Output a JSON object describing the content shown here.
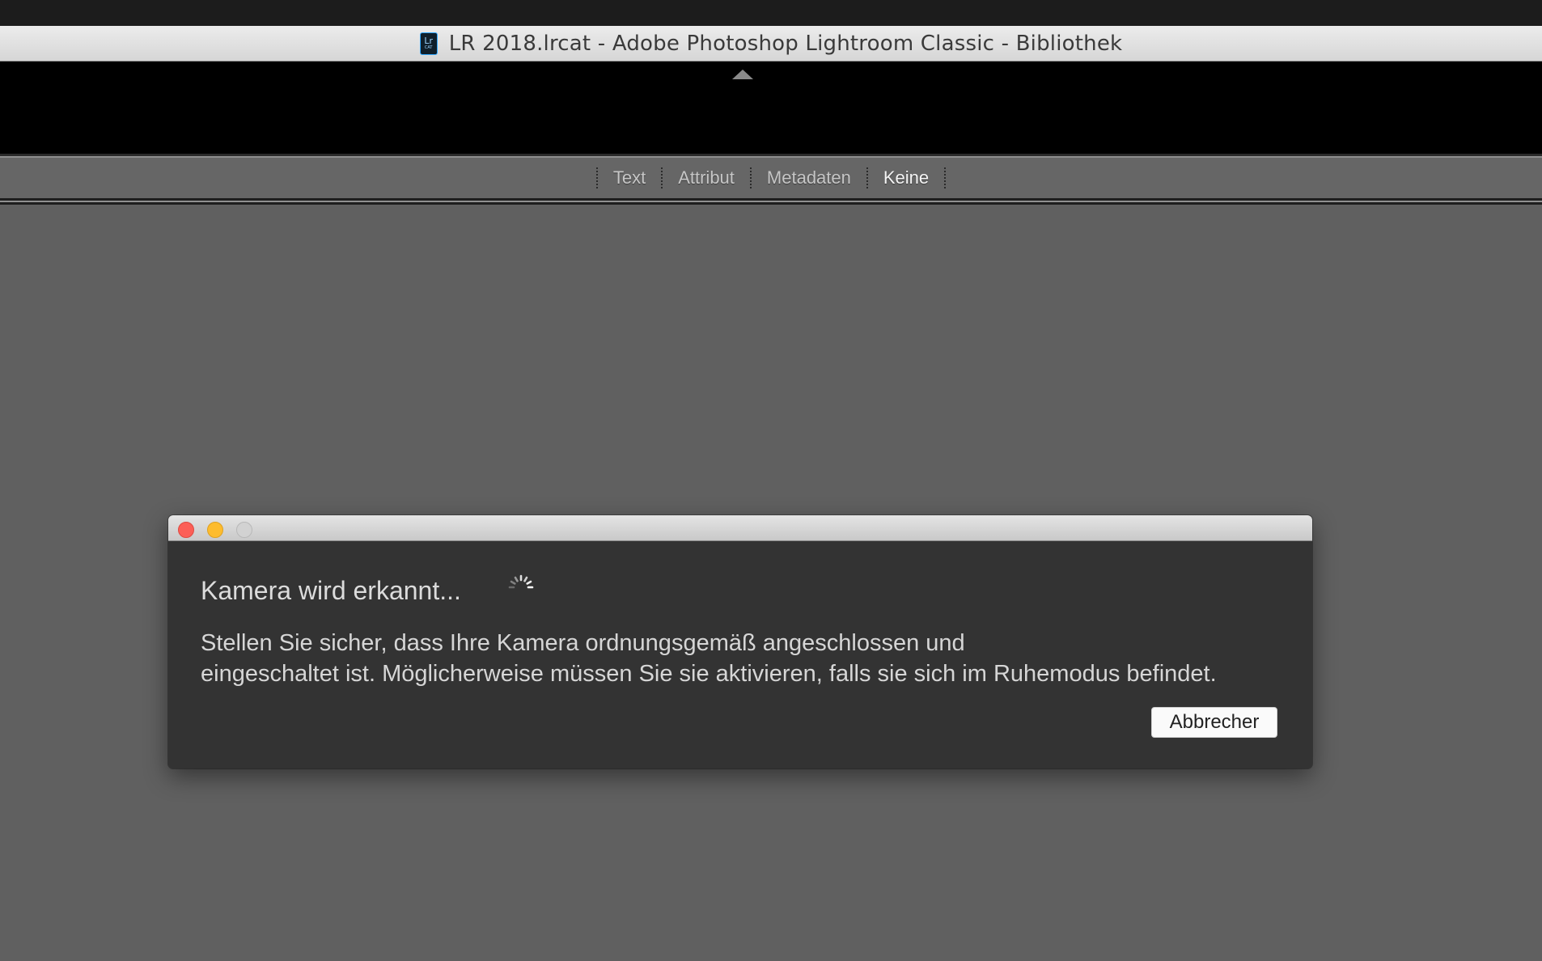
{
  "window": {
    "title": "LR 2018.lrcat - Adobe Photoshop Lightroom Classic - Bibliothek",
    "icon": "lightroom-catalog-icon",
    "icon_text": "Lr",
    "icon_subtext": "CAT"
  },
  "filter_bar": {
    "items": [
      {
        "label": "Text",
        "active": false
      },
      {
        "label": "Attribut",
        "active": false
      },
      {
        "label": "Metadaten",
        "active": false
      },
      {
        "label": "Keine",
        "active": true
      }
    ]
  },
  "dialog": {
    "heading": "Kamera wird erkannt...",
    "message_line1": "Stellen Sie sicher, dass Ihre Kamera ordnungsgemäß angeschlossen und",
    "message_line2": "eingeschaltet ist. Möglicherweise müssen Sie sie aktivieren, falls sie sich im Ruhemodus befindet.",
    "cancel_label": "Abbrecher"
  },
  "colors": {
    "background": "#606060",
    "dialog_bg": "#333333",
    "close": "#fc5f57",
    "minimize": "#fdbc2e",
    "zoom": "#d2d2d2"
  }
}
